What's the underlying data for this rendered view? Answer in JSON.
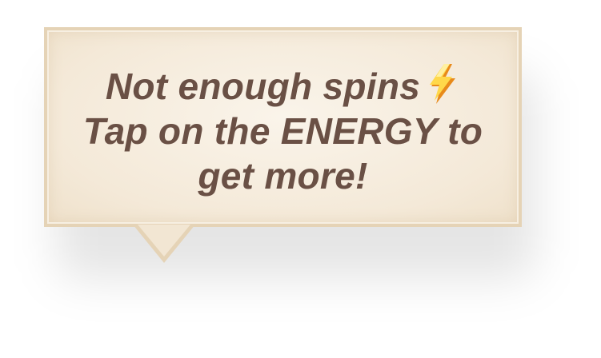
{
  "message": {
    "line1": "Not enough spins",
    "line2": "Tap on the ENERGY to",
    "line3": "get more!",
    "icon": "lightning-bolt-icon"
  },
  "colors": {
    "text": "#6a5045",
    "bubble_fill": "#f4e9d8",
    "bubble_border": "#e5d3b6",
    "bolt_light": "#ffd84a",
    "bolt_dark": "#e88a1a"
  }
}
